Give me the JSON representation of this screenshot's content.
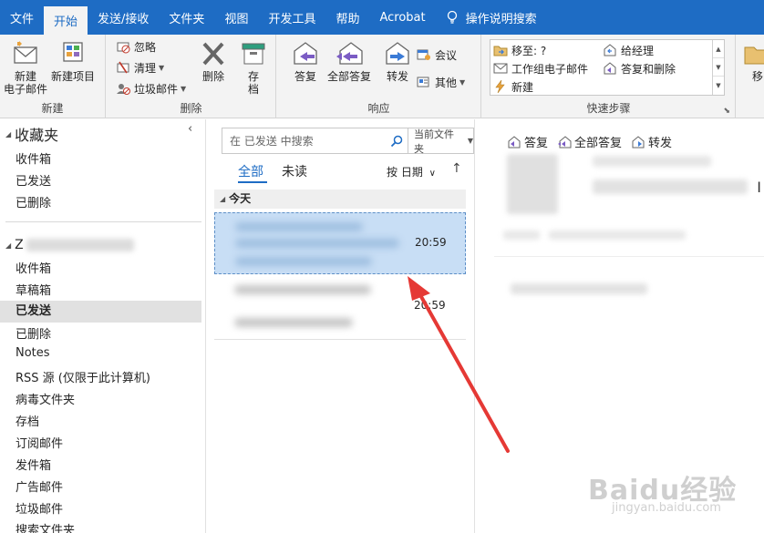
{
  "tabs": [
    {
      "label": "文件"
    },
    {
      "label": "开始",
      "active": true
    },
    {
      "label": "发送/接收"
    },
    {
      "label": "文件夹"
    },
    {
      "label": "视图"
    },
    {
      "label": "开发工具"
    },
    {
      "label": "帮助"
    },
    {
      "label": "Acrobat"
    }
  ],
  "tell_me": "操作说明搜索",
  "ribbon": {
    "new_group": {
      "label": "新建",
      "new_email": "新建\n电子邮件",
      "new_items": "新建项目"
    },
    "delete_group": {
      "label": "删除",
      "ignore": "忽略",
      "cleanup": "清理",
      "junk": "垃圾邮件",
      "delete": "删除",
      "archive": "存\n档"
    },
    "respond_group": {
      "label": "响应",
      "reply": "答复",
      "reply_all": "全部答复",
      "forward": "转发",
      "meeting": "会议",
      "more": "其他"
    },
    "quicksteps_group": {
      "label": "快速步骤",
      "move_to": "移至: ?",
      "team_email": "工作组电子邮件",
      "new": "新建",
      "to_manager": "给经理",
      "reply_delete": "答复和删除"
    },
    "move_partial": "移"
  },
  "folder_pane": {
    "favorites_header": "收藏夹",
    "favorites": [
      "收件箱",
      "已发送",
      "已删除"
    ],
    "account_prefix": "Z",
    "folders": [
      {
        "name": "收件箱"
      },
      {
        "name": "草稿箱"
      },
      {
        "name": "已发送",
        "selected": true
      },
      {
        "name": "已删除"
      },
      {
        "name": "Notes"
      },
      {
        "name": "RSS 源 (仅限于此计算机)"
      },
      {
        "name": "病毒文件夹"
      },
      {
        "name": "存档"
      },
      {
        "name": "订阅邮件"
      },
      {
        "name": "发件箱"
      },
      {
        "name": "广告邮件"
      },
      {
        "name": "垃圾邮件"
      },
      {
        "name": "搜索文件夹"
      }
    ]
  },
  "message_list": {
    "search_placeholder": "在 已发送 中搜索",
    "search_scope": "当前文件夹",
    "filter_all": "全部",
    "filter_unread": "未读",
    "sort_label": "按 日期",
    "group_today": "今天",
    "messages": [
      {
        "time": "20:59",
        "selected": true
      },
      {
        "time": "20:59",
        "selected": false
      }
    ]
  },
  "reading_pane": {
    "reply": "答复",
    "reply_all": "全部答复",
    "forward": "转发"
  },
  "colors": {
    "accent": "#1e6cc4",
    "selection": "#c8def5",
    "arrow": "#e53935"
  },
  "watermark": {
    "brand": "Baidu经验",
    "url": "jingyan.baidu.com"
  }
}
